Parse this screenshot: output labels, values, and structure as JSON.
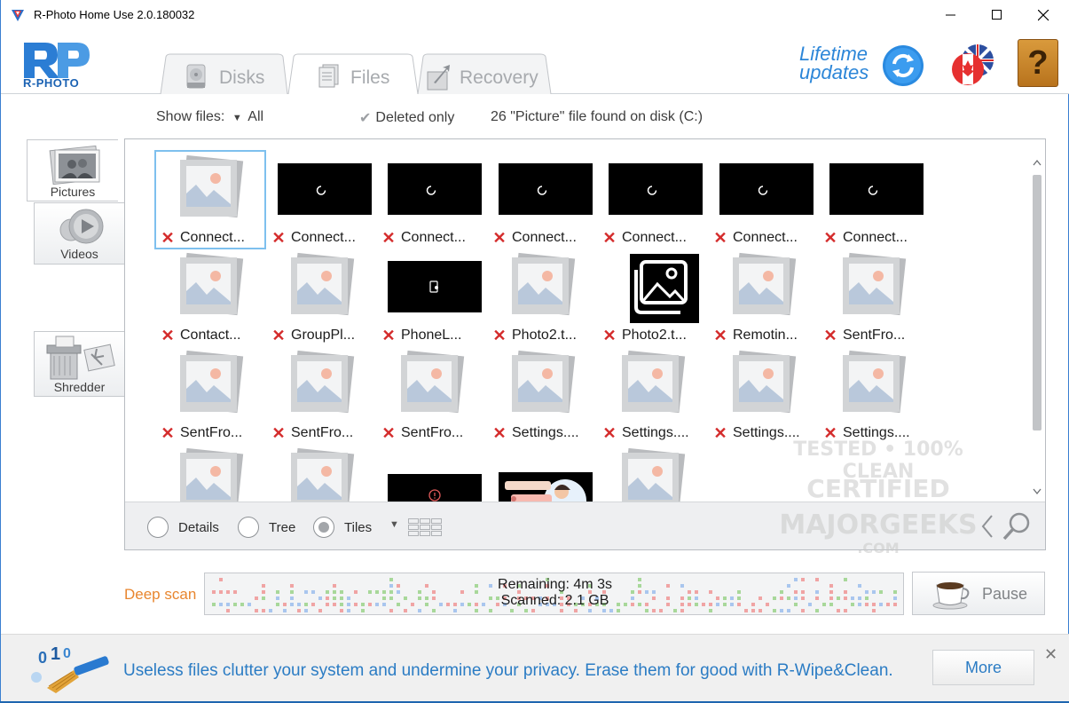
{
  "window": {
    "title": "R-Photo Home Use 2.0.180032"
  },
  "header": {
    "logo_text": "R-PHOTO",
    "tabs": [
      {
        "label": "Disks",
        "icon": "disk-icon"
      },
      {
        "label": "Files",
        "icon": "files-icon"
      },
      {
        "label": "Recovery",
        "icon": "recovery-icon"
      }
    ],
    "active_tab": "Files",
    "lifetime_line1": "Lifetime",
    "lifetime_line2": "updates",
    "help_glyph": "?"
  },
  "toolbar": {
    "show_files_label": "Show files:",
    "show_files_value": "All",
    "deleted_only_label": "Deleted only",
    "deleted_only_checked": true,
    "found_text": "26 \"Picture\" file found on disk (C:)"
  },
  "sidenav": {
    "pictures_label": "Pictures",
    "videos_label": "Videos",
    "shredder_label": "Shredder",
    "active": "Pictures"
  },
  "files": {
    "rows": [
      [
        {
          "name": "Connect...",
          "thumb": "placeholder",
          "selected": true
        },
        {
          "name": "Connect...",
          "thumb": "black-spinner"
        },
        {
          "name": "Connect...",
          "thumb": "black-spinner"
        },
        {
          "name": "Connect...",
          "thumb": "black-spinner"
        },
        {
          "name": "Connect...",
          "thumb": "black-spinner"
        },
        {
          "name": "Connect...",
          "thumb": "black-spinner"
        },
        {
          "name": "Connect...",
          "thumb": "black-spinner"
        }
      ],
      [
        {
          "name": "Contact...",
          "thumb": "placeholder"
        },
        {
          "name": "GroupPl...",
          "thumb": "placeholder"
        },
        {
          "name": "PhoneL...",
          "thumb": "black-phone"
        },
        {
          "name": "Photo2.t...",
          "thumb": "placeholder"
        },
        {
          "name": "Photo2.t...",
          "thumb": "photos-app"
        },
        {
          "name": "Remotin...",
          "thumb": "placeholder"
        },
        {
          "name": "SentFro...",
          "thumb": "placeholder"
        }
      ],
      [
        {
          "name": "SentFro...",
          "thumb": "placeholder"
        },
        {
          "name": "SentFro...",
          "thumb": "placeholder"
        },
        {
          "name": "SentFro...",
          "thumb": "placeholder"
        },
        {
          "name": "Settings....",
          "thumb": "placeholder"
        },
        {
          "name": "Settings....",
          "thumb": "placeholder"
        },
        {
          "name": "Settings....",
          "thumb": "placeholder"
        },
        {
          "name": "Settings....",
          "thumb": "placeholder"
        }
      ],
      [
        {
          "name": "",
          "thumb": "placeholder"
        },
        {
          "name": "",
          "thumb": "placeholder"
        },
        {
          "name": "",
          "thumb": "black-alert"
        },
        {
          "name": "",
          "thumb": "chat-illustration"
        },
        {
          "name": "",
          "thumb": "placeholder"
        }
      ]
    ],
    "deleted_mark": "✕"
  },
  "view": {
    "details_label": "Details",
    "tree_label": "Tree",
    "tiles_label": "Tiles",
    "selected": "Tiles"
  },
  "scan": {
    "label": "Deep scan",
    "remaining": "Remaining: 4m 3s",
    "scanned": "Scanned: 2.1 GB",
    "pause_label": "Pause"
  },
  "footer": {
    "ad_text": "Useless files clutter your system and undermine your privacy. Erase them for good with R-Wipe&Clean.",
    "more_label": "More",
    "close_glyph": "✕"
  },
  "watermark": {
    "line1": "TESTED • 100% CLEAN",
    "line2": "CERTIFIED",
    "line3": "MAJORGEEKS",
    "line4": ".COM"
  },
  "colors": {
    "accent_blue": "#2b7cc4",
    "deep_scan_orange": "#e8862f",
    "deleted_red": "#d42b2b"
  }
}
